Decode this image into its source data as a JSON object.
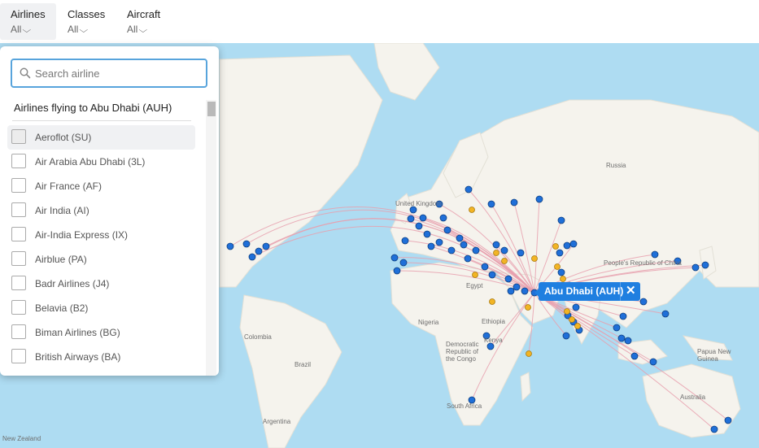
{
  "filters": [
    {
      "label": "Airlines",
      "value": "All"
    },
    {
      "label": "Classes",
      "value": "All"
    },
    {
      "label": "Aircraft",
      "value": "All"
    }
  ],
  "search": {
    "placeholder": "Search airline",
    "value": ""
  },
  "panel_title": "Airlines flying to Abu Dhabi (AUH)",
  "airlines": [
    "Aeroflot (SU)",
    "Air Arabia Abu Dhabi (3L)",
    "Air France (AF)",
    "Air India (AI)",
    "Air-India Express (IX)",
    "Airblue (PA)",
    "Badr Airlines (J4)",
    "Belavia (B2)",
    "Biman Airlines (BG)",
    "British Airways (BA)"
  ],
  "destination_tooltip": "Abu Dhabi (AUH)",
  "map_labels": [
    "Russia",
    "United Kingdom",
    "Egypt",
    "Nigeria",
    "Ethiopia",
    "Kenya",
    "Democratic Republic of the Congo",
    "South Africa",
    "Australia",
    "Papua New Guinea",
    "People's Republic of China",
    "Colombia",
    "Brazil",
    "Argentina",
    "New Zealand"
  ],
  "colors": {
    "route": "#e8a0ae",
    "airport": "#1f6fd8",
    "airport_alt": "#f2b424",
    "ocean": "#aedcf2",
    "land": "#f5f3ed"
  },
  "icons": {
    "search": "search-icon",
    "chevron": "chevron-down-icon",
    "close": "close-icon"
  }
}
